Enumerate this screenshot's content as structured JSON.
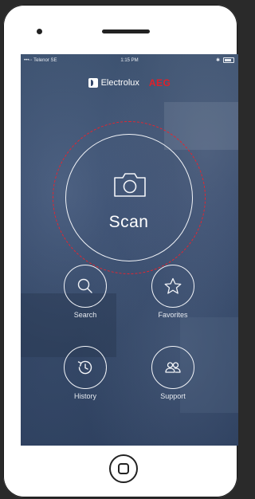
{
  "status_bar": {
    "carrier": "•••◦◦ Telenor SE",
    "time": "1:15 PM",
    "bluetooth_icon": "bluetooth-icon",
    "battery_icon": "battery-icon"
  },
  "brand": {
    "electrolux": "Electrolux",
    "aeg": "AEG",
    "aeg_color": "#e0202a"
  },
  "scan": {
    "label": "Scan",
    "icon": "camera-icon",
    "ring_color": "#e42530"
  },
  "actions": [
    {
      "label": "Search",
      "icon": "search-icon"
    },
    {
      "label": "Favorites",
      "icon": "star-icon"
    },
    {
      "label": "History",
      "icon": "history-icon"
    },
    {
      "label": "Support",
      "icon": "support-icon"
    }
  ]
}
